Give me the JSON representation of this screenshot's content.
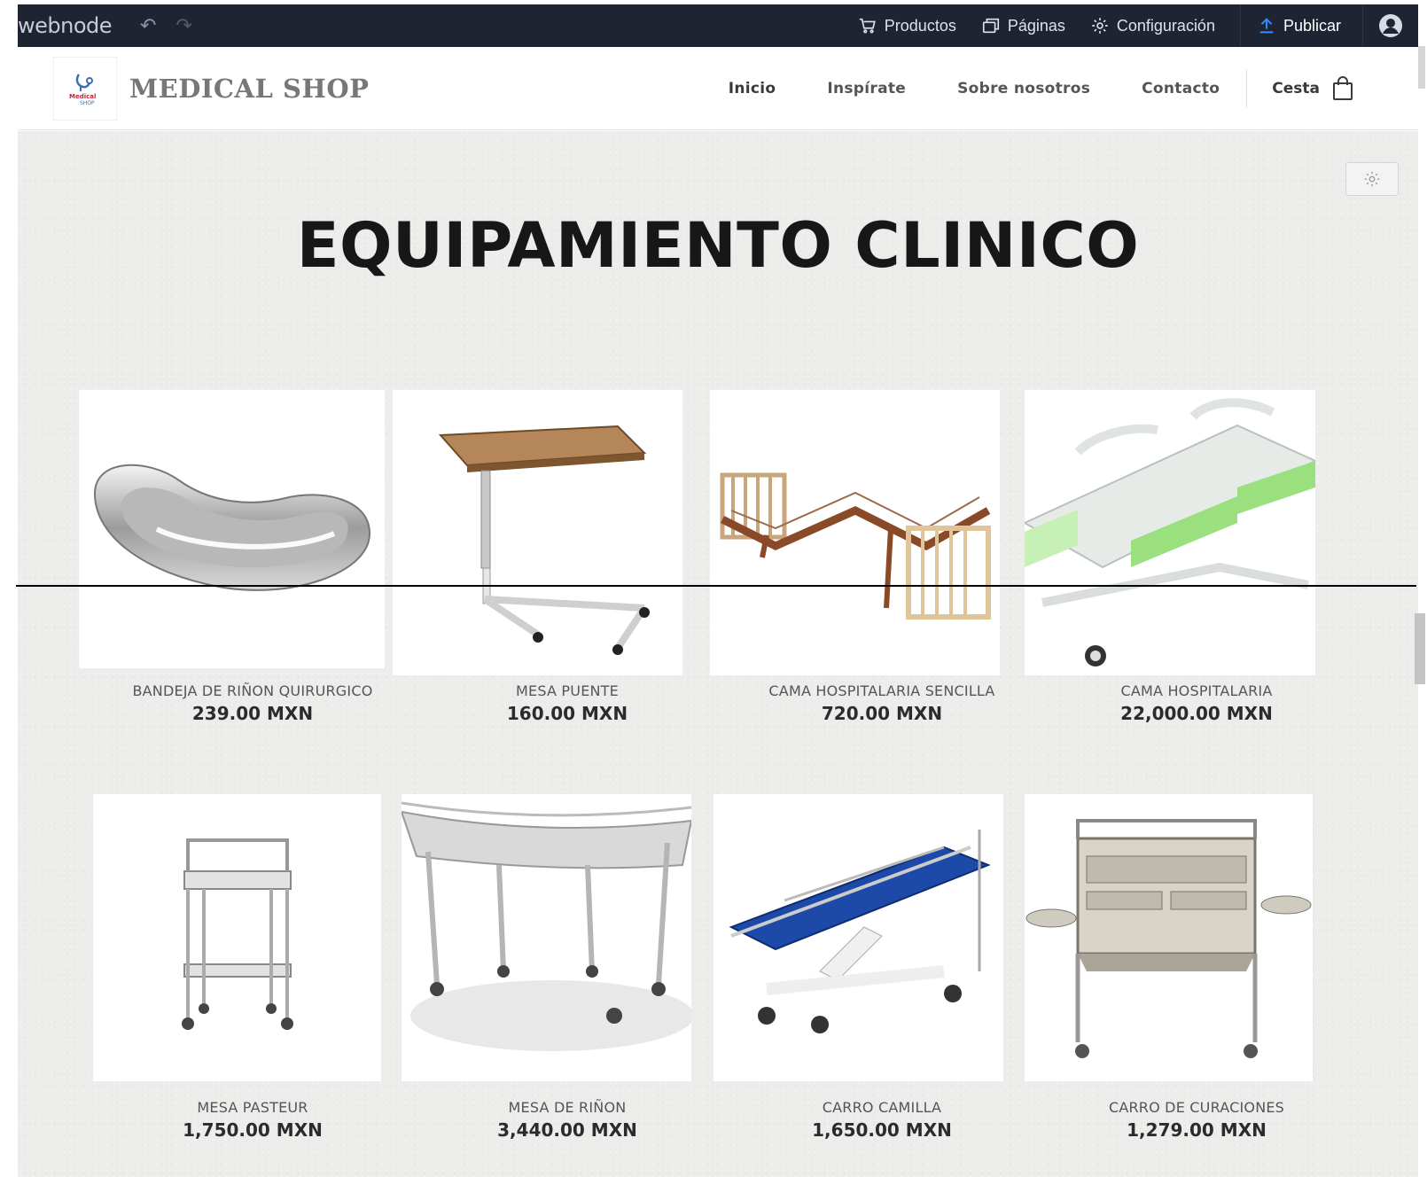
{
  "editor": {
    "brand": "webnode",
    "menu": {
      "productos": "Productos",
      "paginas": "Páginas",
      "configuracion": "Configuración",
      "publicar": "Publicar"
    }
  },
  "site": {
    "title": "MEDICAL SHOP",
    "nav": [
      "Inicio",
      "Inspírate",
      "Sobre nosotros",
      "Contacto"
    ],
    "cart": "Cesta"
  },
  "heading": "EQUIPAMIENTO CLINICO",
  "products": [
    {
      "name": "BANDEJA DE RIÑON QUIRURGICO",
      "price": "239.00 MXN",
      "icon": "kidney-tray-image"
    },
    {
      "name": "MESA PUENTE",
      "price": "160.00 MXN",
      "icon": "overbed-table-image"
    },
    {
      "name": "CAMA HOSPITALARIA SENCILLA",
      "price": "720.00 MXN",
      "icon": "simple-hospital-bed-image"
    },
    {
      "name": "CAMA HOSPITALARIA",
      "price": "22,000.00 MXN",
      "icon": "hospital-bed-image"
    },
    {
      "name": "MESA PASTEUR",
      "price": "1,750.00 MXN",
      "icon": "pasteur-table-image"
    },
    {
      "name": "MESA DE RIÑON",
      "price": "3,440.00 MXN",
      "icon": "kidney-table-image"
    },
    {
      "name": "CARRO CAMILLA",
      "price": "1,650.00 MXN",
      "icon": "stretcher-cart-image"
    },
    {
      "name": "CARRO DE CURACIONES",
      "price": "1,279.00 MXN",
      "icon": "dressing-cart-image"
    }
  ],
  "colors": {
    "editor_bar": "#1f2433",
    "publish_icon": "#2d8cff",
    "background": "#ececeb",
    "heading": "#171717"
  }
}
